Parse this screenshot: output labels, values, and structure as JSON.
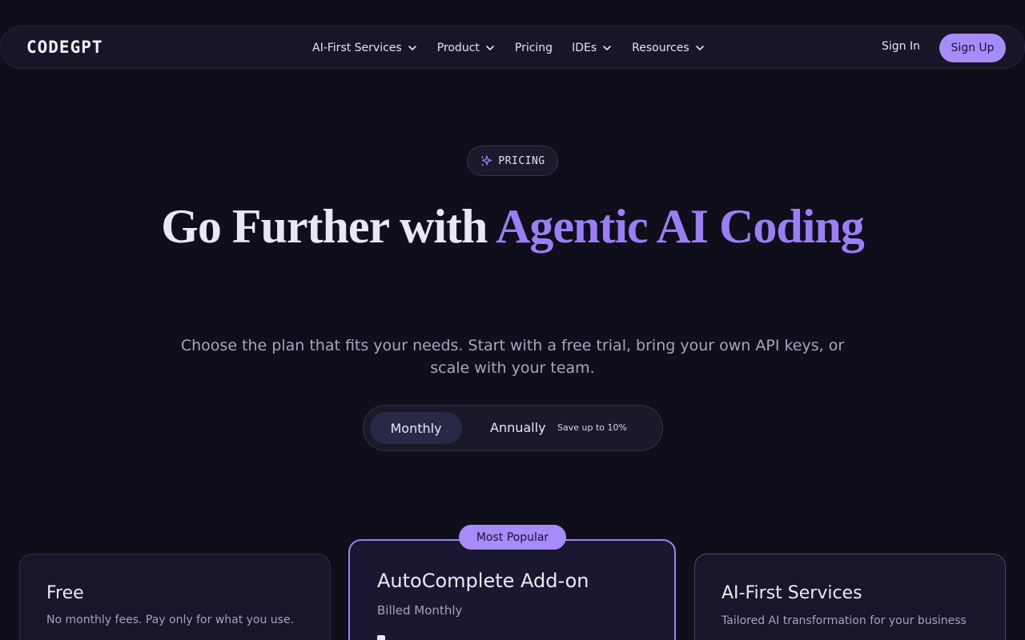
{
  "nav": {
    "logo": "CODEGPT",
    "links": [
      {
        "label": "AI-First Services",
        "dropdown": true
      },
      {
        "label": "Product",
        "dropdown": true
      },
      {
        "label": "Pricing",
        "dropdown": false
      },
      {
        "label": "IDEs",
        "dropdown": true
      },
      {
        "label": "Resources",
        "dropdown": true
      }
    ],
    "sign_in": "Sign In",
    "sign_up": "Sign Up"
  },
  "hero": {
    "badge": "PRICING",
    "title_plain": "Go Further with ",
    "title_accent": "Agentic AI Coding",
    "subtitle": "Choose the plan that fits your needs. Start with a free trial, bring your own API keys, or scale with your team."
  },
  "billing_toggle": {
    "monthly": "Monthly",
    "annually": "Annually",
    "save_note": "Save up to 10%",
    "selected": "Monthly"
  },
  "plans": [
    {
      "title": "Free",
      "desc": "No monthly fees. Pay only for what you use."
    },
    {
      "title": "AutoComplete Add-on",
      "desc": "Billed Monthly",
      "badge": "Most Popular"
    },
    {
      "title": "AI-First Services",
      "desc": "Tailored AI transformation for your business"
    }
  ],
  "colors": {
    "background": "#0f0e1a",
    "accent": "#a58cf8",
    "accent_text": "#9b7ef6"
  }
}
